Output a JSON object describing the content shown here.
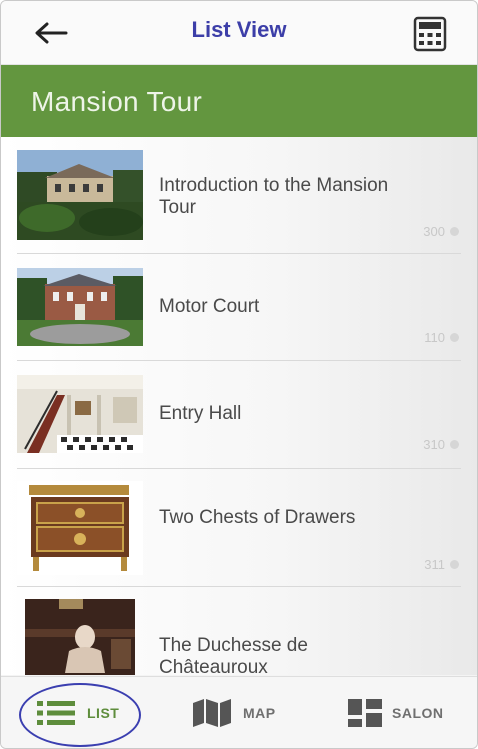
{
  "header": {
    "title": "List View",
    "back_icon": "arrow-left-icon",
    "menu_icon": "grid-menu-icon",
    "title_color": "#3c3ea8"
  },
  "section": {
    "title": "Mansion Tour",
    "color": "#63963f"
  },
  "items": [
    {
      "title": "Introduction to the Mansion Tour",
      "number": "300"
    },
    {
      "title": "Motor Court",
      "number": "110"
    },
    {
      "title": "Entry Hall",
      "number": "310"
    },
    {
      "title": "Two Chests of Drawers",
      "number": "311"
    },
    {
      "title": "The Duchesse de Châteauroux",
      "number": ""
    }
  ],
  "tabs": [
    {
      "label": "LIST",
      "icon": "list-icon",
      "active": true
    },
    {
      "label": "MAP",
      "icon": "map-icon",
      "active": false
    },
    {
      "label": "SALON",
      "icon": "salon-grid-icon",
      "active": false
    }
  ],
  "accent_active_tab": "#5e8d3c",
  "highlight_ring_color": "#3b3fb0"
}
